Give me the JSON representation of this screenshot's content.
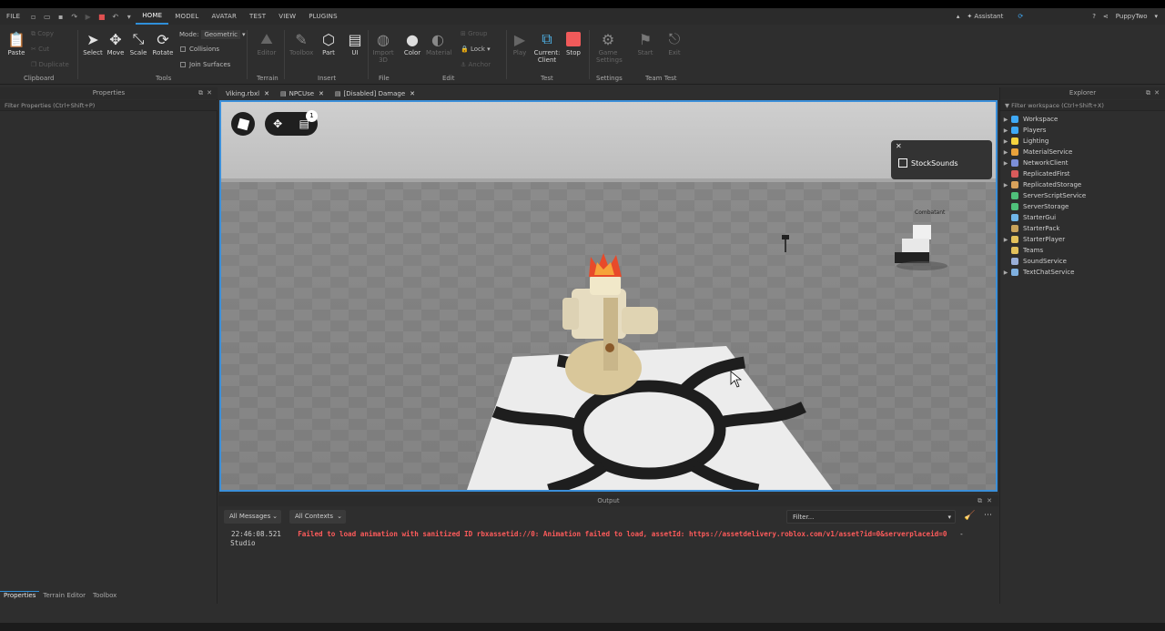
{
  "menu": {
    "file": "FILE",
    "tabs": [
      "HOME",
      "MODEL",
      "AVATAR",
      "TEST",
      "VIEW",
      "PLUGINS"
    ],
    "assistant": "Assistant",
    "user": "PuppyTwo"
  },
  "ribbon": {
    "paste": "Paste",
    "clipboard": "Clipboard",
    "select": "Select",
    "move": "Move",
    "scale": "Scale",
    "rotate": "Rotate",
    "mode_label": "Mode:",
    "mode_value": "Geometric",
    "collisions": "Collisions",
    "join_surfaces": "Join Surfaces",
    "tools": "Tools",
    "terrain": "Terrain",
    "part": "Part",
    "ui": "UI",
    "insert": "Insert",
    "color": "Color",
    "file_group": "File",
    "lock": "Lock",
    "edit": "Edit",
    "current": "Current:",
    "client": "Client",
    "stop": "Stop",
    "test": "Test",
    "settings": "Settings",
    "team_test": "Team Test"
  },
  "properties": {
    "title": "Properties",
    "filter": "Filter Properties (Ctrl+Shift+P)"
  },
  "doc_tabs": [
    {
      "label": "Viking.rbxl"
    },
    {
      "label": "NPCUse"
    },
    {
      "label": "[Disabled] Damage"
    }
  ],
  "viewport": {
    "stock_sounds": "StockSounds",
    "combatant": "Combatant",
    "badge": "1"
  },
  "output": {
    "title": "Output",
    "all_messages": "All Messages",
    "all_contexts": "All Contexts",
    "filter": "Filter...",
    "timestamp": "22:46:08.521",
    "error": "Failed to load animation with sanitized ID rbxassetid://0: Animation failed to load, assetId: https://assetdelivery.roblox.com/v1/asset?id=0&serverplaceid=0",
    "source": "Studio"
  },
  "explorer": {
    "title": "Explorer",
    "filter": "Filter workspace (Ctrl+Shift+X)",
    "items": [
      {
        "label": "Workspace",
        "color": "#3fa9f5",
        "exp": true
      },
      {
        "label": "Players",
        "color": "#3fa9f5",
        "exp": true
      },
      {
        "label": "Lighting",
        "color": "#f5d33f",
        "exp": true
      },
      {
        "label": "MaterialService",
        "color": "#e9a23b",
        "exp": true
      },
      {
        "label": "NetworkClient",
        "color": "#7b8fd9",
        "exp": true
      },
      {
        "label": "ReplicatedFirst",
        "color": "#d95b5b",
        "exp": false
      },
      {
        "label": "ReplicatedStorage",
        "color": "#d9a25b",
        "exp": true
      },
      {
        "label": "ServerScriptService",
        "color": "#4fbf7a",
        "exp": false
      },
      {
        "label": "ServerStorage",
        "color": "#4fbf7a",
        "exp": false
      },
      {
        "label": "StarterGui",
        "color": "#6fb6e9",
        "exp": false
      },
      {
        "label": "StarterPack",
        "color": "#c9a35b",
        "exp": false
      },
      {
        "label": "StarterPlayer",
        "color": "#e3c15b",
        "exp": true
      },
      {
        "label": "Teams",
        "color": "#e3c15b",
        "exp": false
      },
      {
        "label": "SoundService",
        "color": "#9ab0d9",
        "exp": false
      },
      {
        "label": "TextChatService",
        "color": "#7fb0e0",
        "exp": true
      }
    ]
  },
  "bottom_tabs": [
    "Properties",
    "Terrain Editor",
    "Toolbox"
  ]
}
